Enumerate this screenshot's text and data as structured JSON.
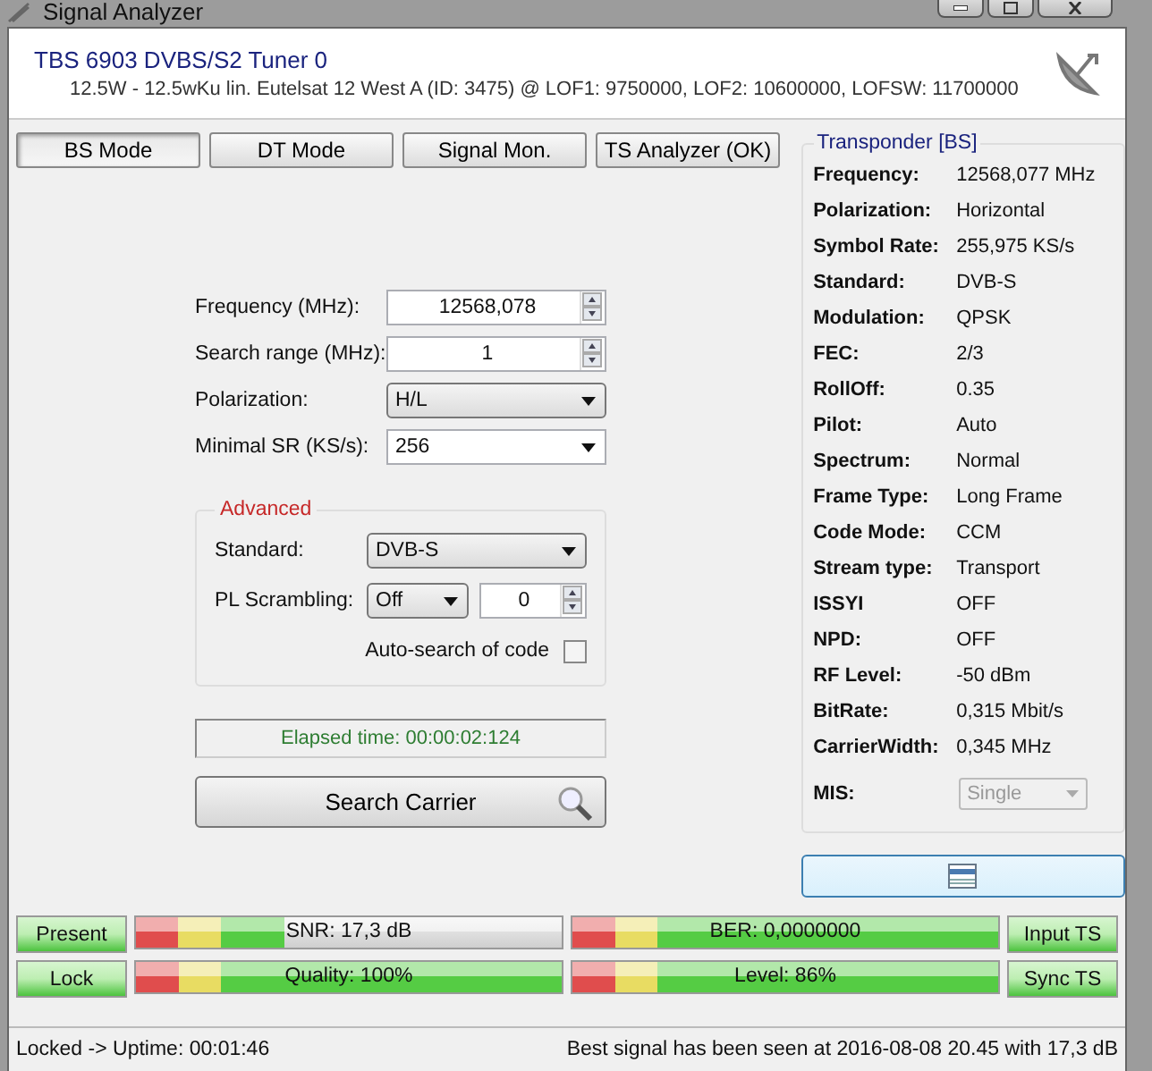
{
  "window": {
    "title": "Signal Analyzer"
  },
  "header": {
    "device": "TBS 6903 DVBS/S2 Tuner 0",
    "details": "12.5W - 12.5wKu lin. Eutelsat 12 West A (ID: 3475) @ LOF1: 9750000, LOF2: 10600000, LOFSW: 11700000"
  },
  "tabs": [
    {
      "label": "BS Mode",
      "selected": true
    },
    {
      "label": "DT Mode",
      "selected": false
    },
    {
      "label": "Signal Mon.",
      "selected": false
    },
    {
      "label": "TS Analyzer (OK)",
      "selected": false
    }
  ],
  "form": [
    {
      "kind": "spin",
      "label": "Frequency (MHz):",
      "value": "12568,078"
    },
    {
      "kind": "spin",
      "label": "Search range (MHz):",
      "value": "1"
    },
    {
      "kind": "select",
      "label": "Polarization:",
      "value": "H/L"
    },
    {
      "kind": "combo",
      "label": "Minimal SR (KS/s):",
      "value": "256"
    }
  ],
  "advanced": {
    "title": "Advanced",
    "standard_label": "Standard:",
    "standard": "DVB-S",
    "scrambling_label": "PL Scrambling:",
    "scrambling": "Off",
    "scrambling_code": "0",
    "auto_search_label": "Auto-search of code",
    "auto_search": false
  },
  "elapsed": "Elapsed time: 00:00:02:124",
  "search_button": "Search Carrier",
  "transponder": {
    "title": "Transponder [BS]",
    "rows": [
      {
        "label": "Frequency:",
        "value": "12568,077 MHz"
      },
      {
        "label": "Polarization:",
        "value": "Horizontal"
      },
      {
        "label": "Symbol Rate:",
        "value": "255,975 KS/s"
      },
      {
        "label": "Standard:",
        "value": "DVB-S"
      },
      {
        "label": "Modulation:",
        "value": "QPSK"
      },
      {
        "label": "FEC:",
        "value": "2/3"
      },
      {
        "label": "RollOff:",
        "value": "0.35"
      },
      {
        "label": "Pilot:",
        "value": "Auto"
      },
      {
        "label": "Spectrum:",
        "value": "Normal"
      },
      {
        "label": "Frame Type:",
        "value": "Long Frame"
      },
      {
        "label": "Code Mode:",
        "value": "CCM"
      },
      {
        "label": "Stream type:",
        "value": "Transport"
      },
      {
        "label": "ISSYI",
        "value": "OFF"
      },
      {
        "label": "NPD:",
        "value": "OFF"
      },
      {
        "label": "RF Level:",
        "value": "-50 dBm"
      },
      {
        "label": "BitRate:",
        "value": "0,315 Mbit/s"
      },
      {
        "label": "CarrierWidth:",
        "value": "0,345 MHz"
      }
    ],
    "mis_label": "MIS:",
    "mis": "Single"
  },
  "indicators": [
    {
      "label": "Present",
      "on": true
    },
    {
      "label": "Lock",
      "on": true
    },
    {
      "label": "Input TS",
      "on": true
    },
    {
      "label": "Sync TS",
      "on": true
    }
  ],
  "meters": [
    {
      "label": "SNR: 17,3 dB",
      "level": 0.35
    },
    {
      "label": "BER: 0,0000000",
      "level": 1
    },
    {
      "label": "Quality: 100%",
      "level": 1
    },
    {
      "label": "Level: 86%",
      "level": 1
    }
  ],
  "status_bar": {
    "left": "Locked -> Uptime: 00:01:46",
    "right": "Best signal has been seen at 2016-08-08 20.45 with 17,3 dB"
  }
}
